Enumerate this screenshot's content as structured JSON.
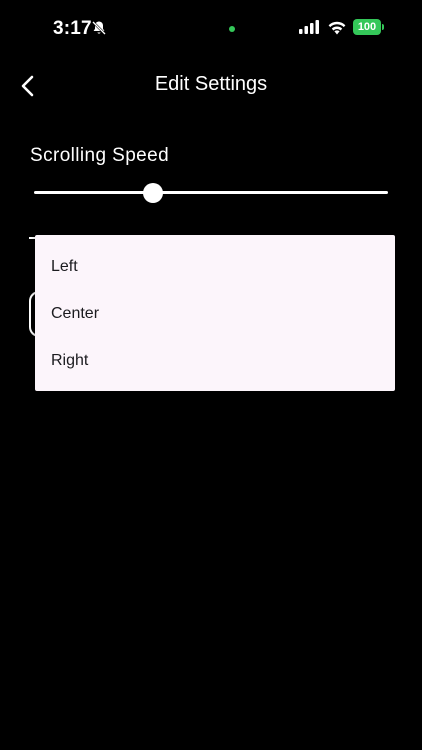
{
  "status_bar": {
    "time": "3:17",
    "battery": "100",
    "icons": [
      "bell-slash-icon",
      "cellular-signal-icon",
      "wifi-icon",
      "battery-icon"
    ],
    "colors": {
      "indicator_dot": "#34c759",
      "battery": "#34c759"
    }
  },
  "header": {
    "title": "Edit Settings",
    "back_icon": "chevron-left-icon"
  },
  "scrolling_speed": {
    "label": "Scrolling Speed",
    "value_fraction": 0.335
  },
  "dropdown": {
    "options": [
      "Left",
      "Center",
      "Right"
    ],
    "background": "#fcf5fb"
  },
  "colors": {
    "background": "#000000",
    "foreground": "#ffffff"
  }
}
